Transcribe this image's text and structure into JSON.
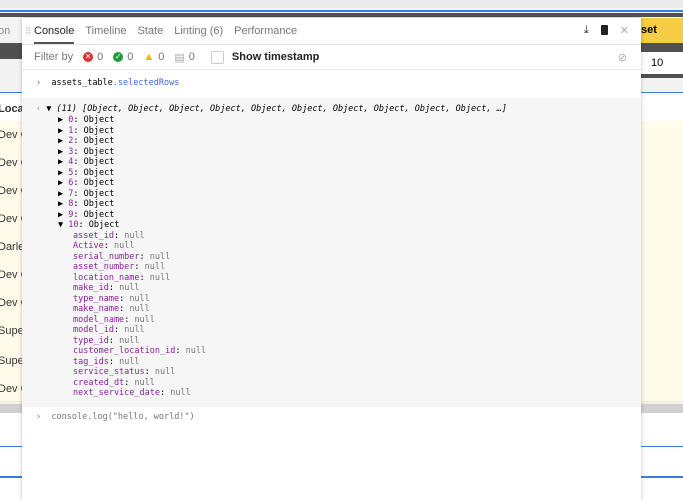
{
  "background": {
    "left_labels": [
      "Locat",
      "Dev C",
      "Dev C",
      "Dev C",
      "Dev C",
      "Darle",
      "Dev C",
      "Dev C",
      "Supe",
      "Supe",
      "Dev C"
    ],
    "left_header": "on",
    "right_button": "set",
    "right_value": "10"
  },
  "tabs": [
    {
      "label": "Console",
      "active": true
    },
    {
      "label": "Timeline"
    },
    {
      "label": "State"
    },
    {
      "label": "Linting (6)"
    },
    {
      "label": "Performance"
    }
  ],
  "toolbar_icons": [
    "download-icon",
    "clipboard-icon",
    "close-icon"
  ],
  "filter": {
    "label": "Filter by",
    "errors": "0",
    "success": "0",
    "warnings": "0",
    "messages": "0",
    "show_timestamp": "Show timestamp"
  },
  "colors": {
    "error": "#d9302c",
    "success": "#1f9d3a",
    "warning": "#f2b400",
    "accent": "#3d7be0"
  },
  "console": {
    "input1": {
      "object": "assets_table",
      "prop": ".selectedRows"
    },
    "summary": "▼ (11) [Object, Object, Object, Object, Object, Object, Object, Object, Object, Object, …]",
    "items": [
      "0",
      "1",
      "2",
      "3",
      "4",
      "5",
      "6",
      "7",
      "8",
      "9"
    ],
    "item_value": "Object",
    "expanded": {
      "index": "10",
      "value": "Object",
      "fields": [
        "asset_id",
        "Active",
        "serial_number",
        "asset_number",
        "location_name",
        "make_id",
        "type_name",
        "make_name",
        "model_name",
        "model_id",
        "type_id",
        "customer_location_id",
        "tag_ids",
        "service_status",
        "created_dt",
        "next_service_date"
      ],
      "field_value": "null"
    },
    "input2": "console.log(\"hello, world!\")"
  }
}
